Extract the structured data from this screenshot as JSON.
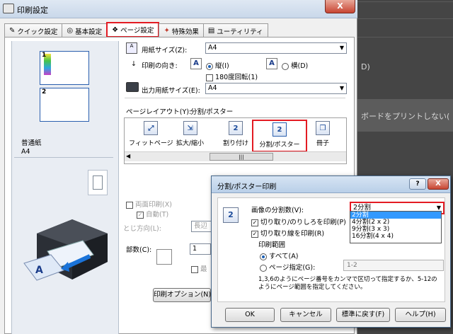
{
  "window": {
    "title": "印刷設定",
    "close_label": "X"
  },
  "tabs": [
    {
      "label": "クイック設定",
      "icon": "quick-icon"
    },
    {
      "label": "基本設定",
      "icon": "basic-icon"
    },
    {
      "label": "ページ設定",
      "icon": "page-icon",
      "active": true
    },
    {
      "label": "特殊効果",
      "icon": "effects-icon"
    },
    {
      "label": "ユーティリティ",
      "icon": "utility-icon"
    }
  ],
  "preview": {
    "page1": "1",
    "page2": "2",
    "paper_type": "普通紙",
    "paper_size": "A4"
  },
  "page_setup": {
    "paper_size_label": "用紙サイズ(Z):",
    "paper_size_value": "A4",
    "orientation_label": "印刷の向き:",
    "portrait_label": "縦(I)",
    "landscape_label": "横(D)",
    "rotate_label": "180度回転(1)",
    "output_size_label": "出力用紙サイズ(E):",
    "output_size_value": "A4",
    "layout_label": "ページレイアウト(Y):",
    "layout_value": "分割/ポスター",
    "layouts": [
      {
        "label": "フィットページ",
        "icon": "fit-page-icon"
      },
      {
        "label": "拡大/縮小",
        "icon": "scale-icon"
      },
      {
        "label": "割り付け",
        "icon": "n-up-icon",
        "glyph": "2"
      },
      {
        "label": "分割/ポスター",
        "icon": "poster-icon",
        "glyph": "2",
        "selected": true
      },
      {
        "label": "冊子",
        "icon": "booklet-icon"
      }
    ],
    "scroll_marker": "|||",
    "duplex_label": "両面印刷(X)",
    "auto_label": "自動(T)",
    "binding_label": "とじ方向(L):",
    "binding_value": "長辺",
    "copies_label": "部数(C):",
    "copies_value": "1",
    "collate_label": "最",
    "print_options_label": "印刷オプション(N)"
  },
  "poster_dialog": {
    "title": "分割/ポスター印刷",
    "help_label": "?",
    "close_label": "X",
    "count_label": "画像の分割数(V):",
    "count_value": "2分割",
    "count_options": [
      "2分割",
      "4分割(2 x 2)",
      "9分割(3 x 3)",
      "16分割(4 x 4)"
    ],
    "trim_label": "切り取り/のりしろを印刷(P)",
    "cutline_label": "切り取り線を印刷(R)",
    "range_label": "印刷範囲",
    "all_label": "すべて(A)",
    "page_spec_label": "ページ指定(G):",
    "page_spec_placeholder": "1-2",
    "hint": "1,3,6のようにページ番号をカンマで区切って指定するか、5-12のようにページ範囲を指定してください。",
    "ok_label": "OK",
    "cancel_label": "キャンセル",
    "default_label": "標準に戻す(F)",
    "help_button_label": "ヘルプ(H)"
  },
  "background": {
    "text1": "D)",
    "text2": "ボードをプリントしない("
  },
  "colors": {
    "accent": "#e31b23",
    "selection": "#3399ff"
  }
}
